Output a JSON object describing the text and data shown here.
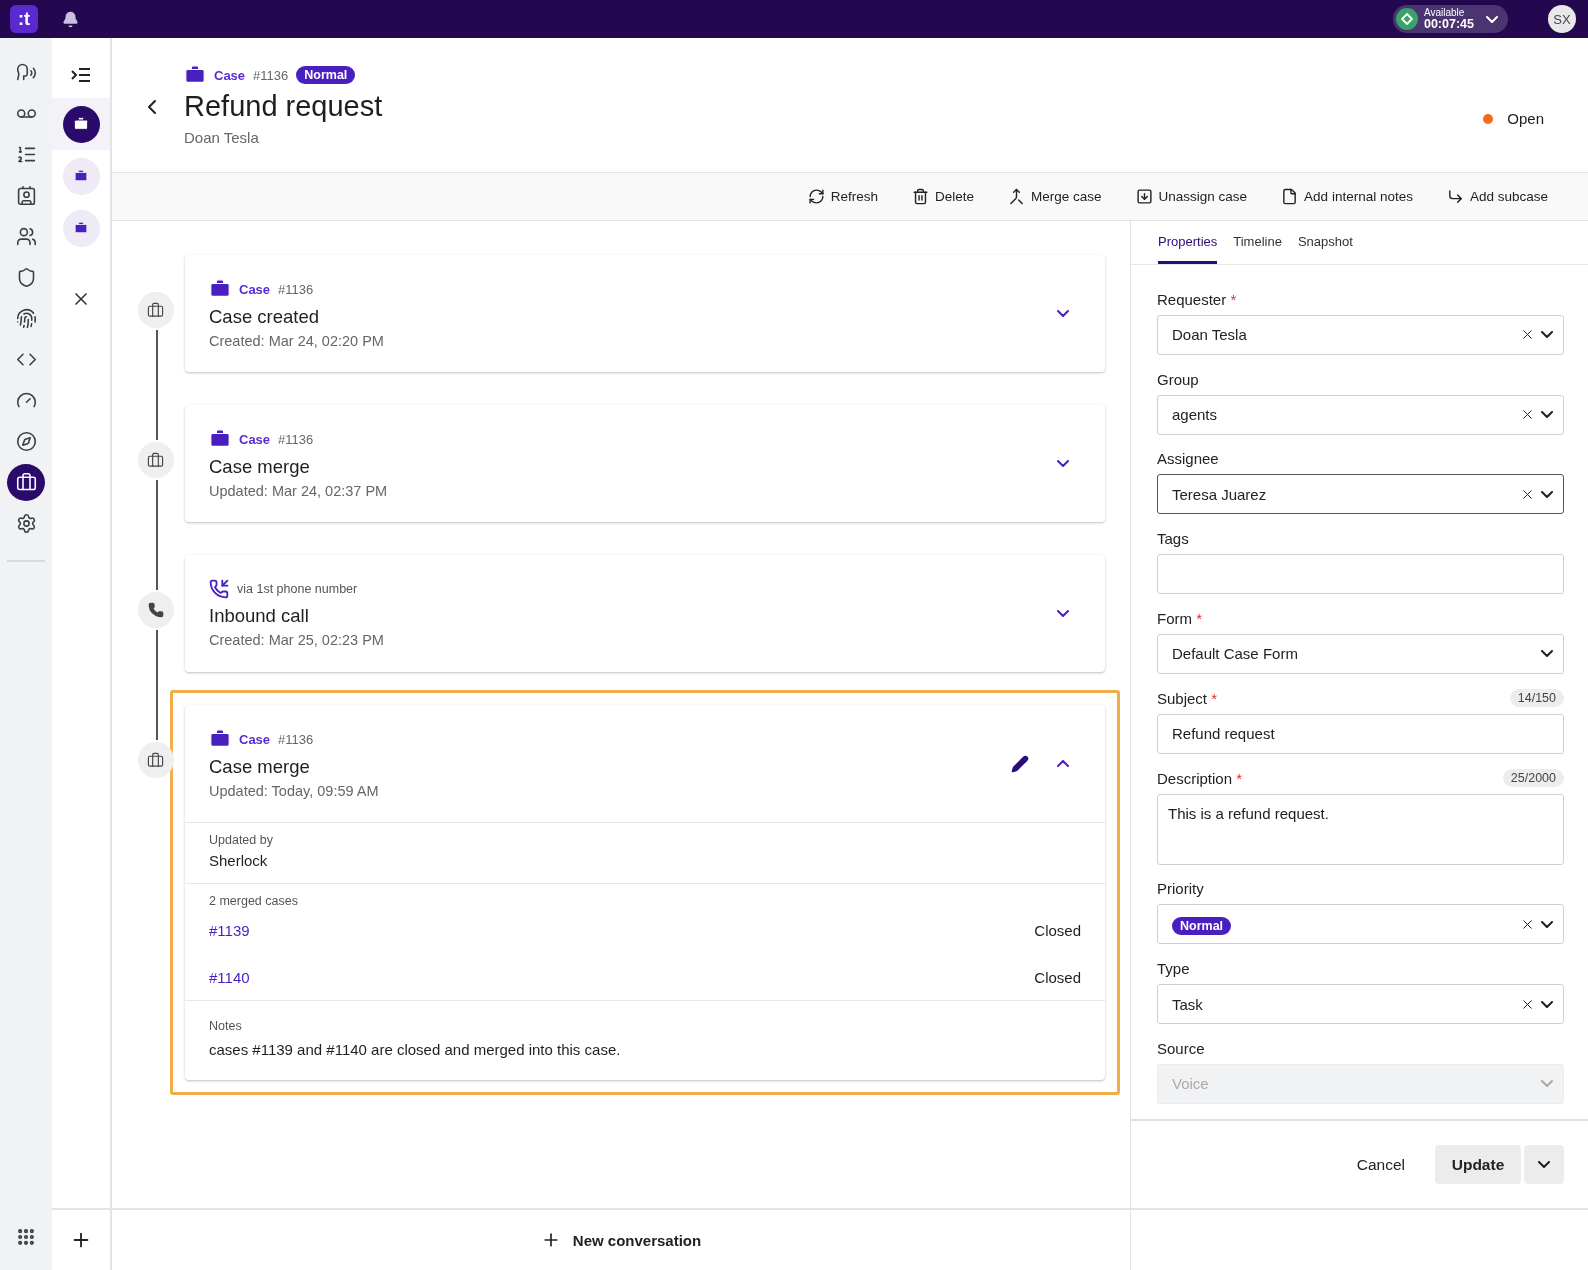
{
  "top_bar": {
    "logo": ":t",
    "agent_status": {
      "label": "Available",
      "timer": "00:07:45"
    },
    "avatar": "SX"
  },
  "rail": {
    "items": [
      {
        "selected": false
      },
      {
        "selected": false
      },
      {
        "selected": false
      },
      {
        "selected": false
      },
      {
        "selected": false
      },
      {
        "selected": false
      },
      {
        "selected": false
      },
      {
        "selected": false
      },
      {
        "selected": false
      },
      {
        "selected": false
      },
      {
        "selected": true
      },
      {
        "selected": false
      }
    ]
  },
  "case_tabs": [
    {
      "selected": true
    },
    {
      "selected": false
    },
    {
      "selected": false
    }
  ],
  "header": {
    "case_label": "Case",
    "case_number": "#1136",
    "priority": "Normal",
    "title": "Refund request",
    "requester": "Doan Tesla",
    "status": "Open"
  },
  "toolbar": [
    {
      "label": "Refresh"
    },
    {
      "label": "Delete"
    },
    {
      "label": "Merge case"
    },
    {
      "label": "Unassign case"
    },
    {
      "label": "Add internal notes"
    },
    {
      "label": "Add subcase"
    }
  ],
  "timeline": [
    {
      "kind": "case",
      "label": "Case",
      "number": "#1136",
      "title": "Case created",
      "meta": "Created: Mar 24, 02:20 PM",
      "expanded": false,
      "highlighted": false
    },
    {
      "kind": "case",
      "label": "Case",
      "number": "#1136",
      "title": "Case merge",
      "meta": "Updated: Mar 24, 02:37 PM",
      "expanded": false,
      "highlighted": false
    },
    {
      "kind": "call",
      "via": "via 1st phone number",
      "title": "Inbound call",
      "meta": "Created: Mar 25, 02:23 PM",
      "expanded": false,
      "highlighted": false
    },
    {
      "kind": "case",
      "label": "Case",
      "number": "#1136",
      "title": "Case merge",
      "meta": "Updated: Today, 09:59 AM",
      "expanded": true,
      "highlighted": true,
      "details": {
        "updated_by_label": "Updated by",
        "updated_by": "Sherlock",
        "merged_label": "2 merged cases",
        "merged": [
          {
            "number": "#1139",
            "status": "Closed"
          },
          {
            "number": "#1140",
            "status": "Closed"
          }
        ],
        "notes_label": "Notes",
        "notes": "cases #1139 and #1140 are closed and merged into this case."
      }
    }
  ],
  "properties": {
    "tabs": [
      {
        "label": "Properties",
        "selected": true
      },
      {
        "label": "Timeline",
        "selected": false
      },
      {
        "label": "Snapshot",
        "selected": false
      }
    ],
    "fields": [
      {
        "kind": "select",
        "label": "Requester",
        "required": true,
        "value": "Doan Tesla",
        "clearable": true,
        "focused": false,
        "disabled": false
      },
      {
        "kind": "select",
        "label": "Group",
        "required": false,
        "value": "agents",
        "clearable": true,
        "focused": false,
        "disabled": false
      },
      {
        "kind": "select",
        "label": "Assignee",
        "required": false,
        "value": "Teresa Juarez",
        "clearable": true,
        "focused": true,
        "disabled": false
      },
      {
        "kind": "text",
        "label": "Tags",
        "required": false,
        "focused": false,
        "disabled": false
      },
      {
        "kind": "select",
        "label": "Form",
        "required": true,
        "value": "Default Case Form",
        "clearable": false,
        "focused": false,
        "disabled": false
      },
      {
        "kind": "text",
        "label": "Subject",
        "required": true,
        "counter": "14/150",
        "value": "Refund request",
        "focused": false,
        "disabled": false
      },
      {
        "kind": "textarea",
        "label": "Description",
        "required": true,
        "counter": "25/2000",
        "value": "This is a refund request.",
        "focused": false,
        "disabled": false
      },
      {
        "kind": "chip",
        "label": "Priority",
        "required": false,
        "value": "Normal",
        "clearable": true,
        "focused": false,
        "disabled": false
      },
      {
        "kind": "select",
        "label": "Type",
        "required": false,
        "value": "Task",
        "clearable": true,
        "focused": false,
        "disabled": false
      },
      {
        "kind": "select",
        "label": "Source",
        "required": false,
        "value": "Voice",
        "clearable": false,
        "focused": false,
        "disabled": true
      }
    ],
    "required_mark": "*",
    "actions": {
      "cancel": "Cancel",
      "update": "Update"
    }
  },
  "footer": {
    "new_conversation": "New conversation"
  }
}
